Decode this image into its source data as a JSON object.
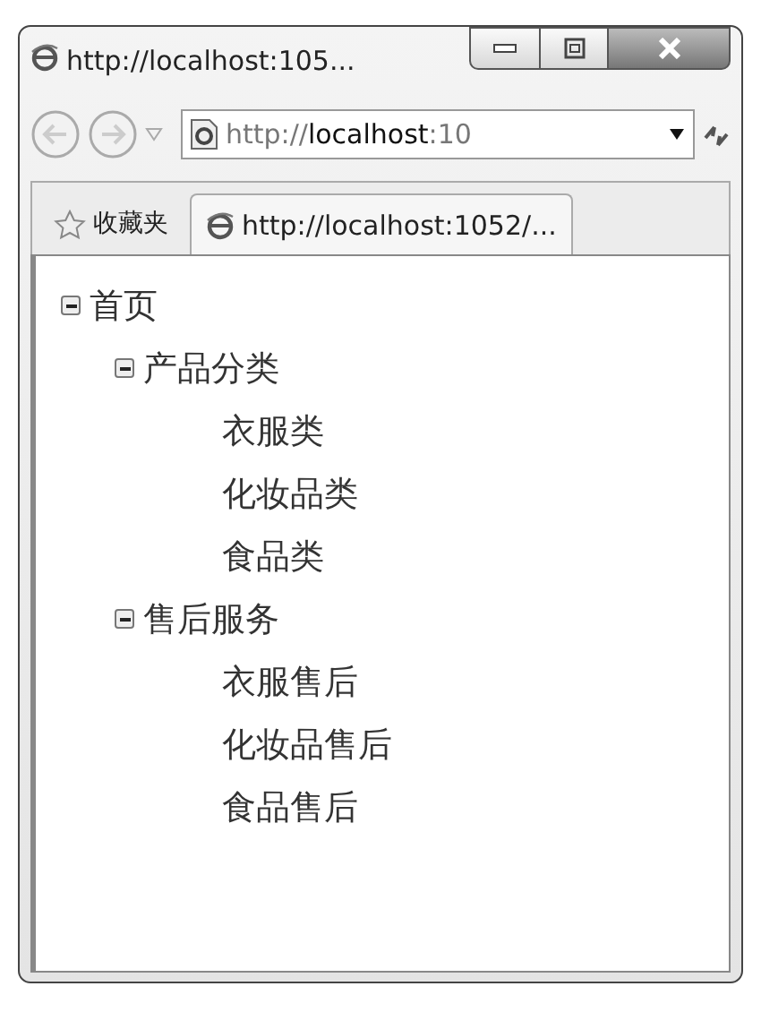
{
  "window": {
    "title": "http://localhost:105..."
  },
  "address_bar": {
    "url": "http://**localhost**:10"
  },
  "favorites": {
    "label": "收藏夹"
  },
  "tabs": [
    {
      "label": "http://localhost:1052/...",
      "selected": true
    }
  ],
  "tree": [
    {
      "label": "首页",
      "expanded": true,
      "children": [
        {
          "label": "产品分类",
          "expanded": true,
          "children": [
            {
              "label": "衣服类"
            },
            {
              "label": "化妆品类"
            },
            {
              "label": "食品类"
            }
          ]
        },
        {
          "label": "售后服务",
          "expanded": true,
          "children": [
            {
              "label": "衣服售后"
            },
            {
              "label": "化妆品售后"
            },
            {
              "label": "食品售后"
            }
          ]
        }
      ]
    }
  ]
}
